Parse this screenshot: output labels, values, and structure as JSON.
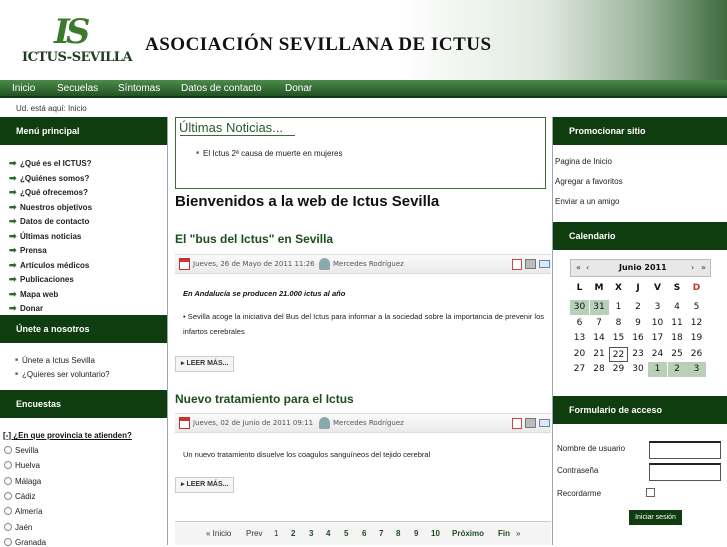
{
  "header": {
    "logo_mark": "IS",
    "logo_text": "ICTUS-SEVILLA",
    "title": "ASOCIACIÓN SEVILLANA DE ICTUS"
  },
  "nav": [
    "Inicio",
    "Secuelas",
    "Síntomas",
    "Datos de contacto",
    "Donar"
  ],
  "breadcrumb": "Ud. está aquí: Inicio",
  "left": {
    "menu_title": "Menú principal",
    "menu": [
      "¿Qué es el ICTUS?",
      "¿Quiénes somos?",
      "¿Qué ofrecemos?",
      "Nuestros objetivos",
      "Datos de contacto",
      "Últimas noticias",
      "Prensa",
      "Artículos médicos",
      "Publicaciones",
      "Mapa web",
      "Donar"
    ],
    "join_title": "Únete a nosotros",
    "join": [
      "Únete a Ictus Sevilla",
      "¿Quieres ser voluntario?"
    ],
    "poll_title": "Encuestas",
    "poll_question": "¿En que provincia te atienden?",
    "poll_options": [
      "Sevilla",
      "Huelva",
      "Málaga",
      "Cádiz",
      "Almería",
      "Jaén",
      "Granada"
    ]
  },
  "main": {
    "news_title": "Últimas Noticias...",
    "news_item": "El Ictus 2ª causa de muerte en mujeres",
    "welcome": "Bienvenidos a la web de Ictus Sevilla",
    "articles": [
      {
        "title": "El \"bus del Ictus\" en Sevilla",
        "date": "Jueves, 26 de Mayo de 2011 11:26",
        "author": "Mercedes Rodríguez",
        "lead": "En Andalucía se producen 21.000 ictus al año",
        "body": "• Sevilla acoge la iniciativa del Bus del Ictus para informar a la sociedad sobre la importancia de prevenir los infartos cerebrales",
        "more": "LEER MÁS..."
      },
      {
        "title": "Nuevo tratamiento para el Ictus",
        "date": "Jueves, 02 de Junio de 2011 09:11",
        "author": "Mercedes Rodríguez",
        "body": "Un nuevo tratamiento disuelve los coagulos sanguíneos del tejido cerebral",
        "more": "LEER MÁS..."
      }
    ],
    "pager": {
      "first": "« Inicio",
      "prev": "Prev",
      "pages": [
        "1",
        "2",
        "3",
        "4",
        "5",
        "6",
        "7",
        "8",
        "9",
        "10"
      ],
      "next": "Próximo",
      "last": "Fin",
      "end": "»"
    }
  },
  "right": {
    "promo_title": "Promocionar sitio",
    "promo_links": [
      "Pagina de Inicio",
      "Agregar a favoritos",
      "Enviar a un amigo"
    ],
    "cal_title": "Calendario",
    "cal_month": "Junio 2011",
    "cal_nav": [
      "«",
      "‹",
      "›",
      "»"
    ],
    "cal_dow": [
      "L",
      "M",
      "X",
      "J",
      "V",
      "S",
      "D"
    ],
    "cal_weeks": [
      [
        "30",
        "31",
        "1",
        "2",
        "3",
        "4",
        "5"
      ],
      [
        "6",
        "7",
        "8",
        "9",
        "10",
        "11",
        "12"
      ],
      [
        "13",
        "14",
        "15",
        "16",
        "17",
        "18",
        "19"
      ],
      [
        "20",
        "21",
        "22",
        "23",
        "24",
        "25",
        "26"
      ],
      [
        "27",
        "28",
        "29",
        "30",
        "1",
        "2",
        "3"
      ]
    ],
    "login_title": "Formulario de acceso",
    "username_label": "Nombre de usuario",
    "password_label": "Contraseña",
    "remember_label": "Recordarme",
    "login_button": "Iniciar sesión"
  },
  "colors": {
    "nav_bg": "#2e6a2e",
    "section_header": "#0f3d0f",
    "link_green": "#1e4e1e",
    "calendar_other": "#b8cfb8",
    "sunday_red": "#c0392b"
  }
}
